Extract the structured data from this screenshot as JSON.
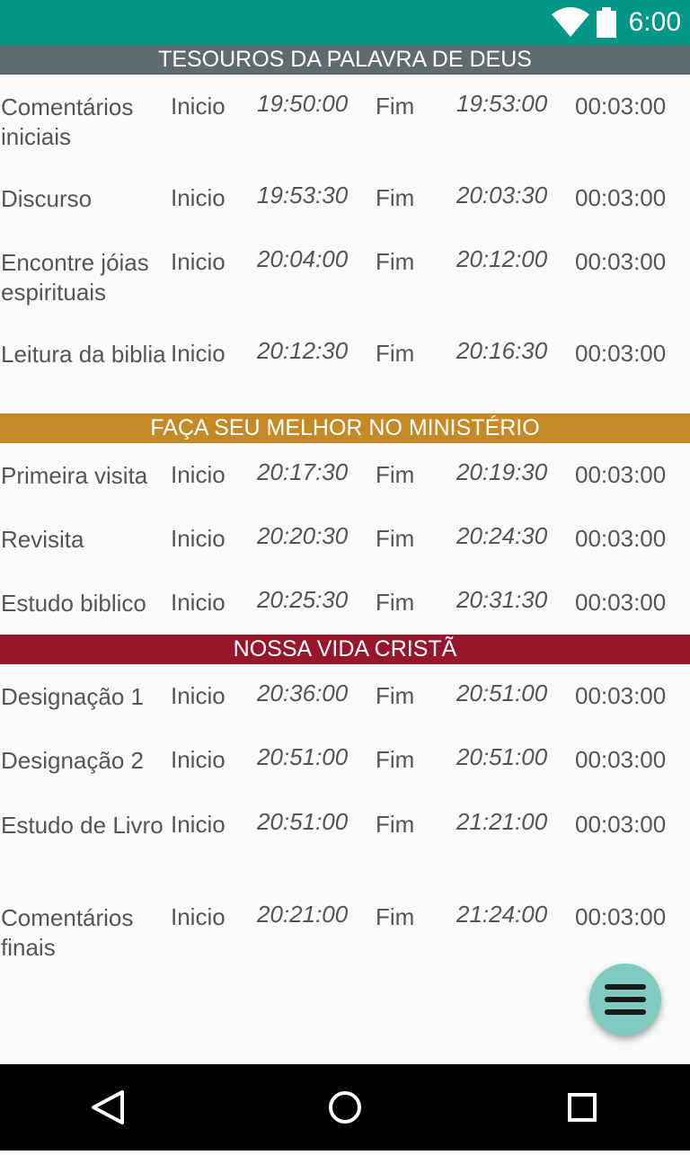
{
  "status_bar": {
    "time": "6:00"
  },
  "sections": [
    {
      "title": "TESOUROS DA PALAVRA DE DEUS",
      "color": "#5f6b72"
    },
    {
      "title": "FAÇA SEU MELHOR NO MINISTÉRIO",
      "color": "#c58a26"
    },
    {
      "title": "NOSSA VIDA CRISTÃ",
      "color": "#99162a"
    }
  ],
  "rows": [
    {
      "label": "Comentários iniciais",
      "inicio": "Inicio",
      "start": "19:50:00",
      "fim": "Fim",
      "end": "19:53:00",
      "duration": "00:03:00"
    },
    {
      "label": "Discurso",
      "inicio": "Inicio",
      "start": "19:53:30",
      "fim": "Fim",
      "end": "20:03:30",
      "duration": "00:03:00"
    },
    {
      "label": "Encontre jóias espirituais",
      "inicio": "Inicio",
      "start": "20:04:00",
      "fim": "Fim",
      "end": "20:12:00",
      "duration": "00:03:00"
    },
    {
      "label": "Leitura da biblia",
      "inicio": "Inicio",
      "start": "20:12:30",
      "fim": "Fim",
      "end": "20:16:30",
      "duration": "00:03:00"
    },
    {
      "label": "Primeira visita",
      "inicio": "Inicio",
      "start": "20:17:30",
      "fim": "Fim",
      "end": "20:19:30",
      "duration": "00:03:00"
    },
    {
      "label": "Revisita",
      "inicio": "Inicio",
      "start": "20:20:30",
      "fim": "Fim",
      "end": "20:24:30",
      "duration": "00:03:00"
    },
    {
      "label": "Estudo biblico",
      "inicio": "Inicio",
      "start": "20:25:30",
      "fim": "Fim",
      "end": "20:31:30",
      "duration": "00:03:00"
    },
    {
      "label": "Designação 1",
      "inicio": "Inicio",
      "start": "20:36:00",
      "fim": "Fim",
      "end": "20:51:00",
      "duration": "00:03:00"
    },
    {
      "label": "Designação 2",
      "inicio": "Inicio",
      "start": "20:51:00",
      "fim": "Fim",
      "end": "20:51:00",
      "duration": "00:03:00"
    },
    {
      "label": "Estudo de Livro",
      "inicio": "Inicio",
      "start": "20:51:00",
      "fim": "Fim",
      "end": "21:21:00",
      "duration": "00:03:00"
    },
    {
      "label": "Comentários finais",
      "inicio": "Inicio",
      "start": "20:21:00",
      "fim": "Fim",
      "end": "21:24:00",
      "duration": "00:03:00"
    }
  ],
  "fab": {
    "icon": "menu-icon"
  },
  "nav_bar": {
    "icons": [
      "back-icon",
      "home-icon",
      "recents-icon"
    ]
  }
}
